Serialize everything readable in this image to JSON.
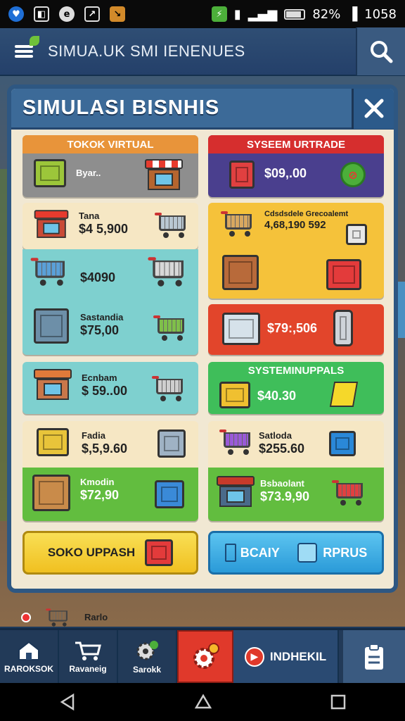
{
  "status_bar": {
    "battery_percent": "82%",
    "time": "1058"
  },
  "app_bar": {
    "title": "SIMUA.UK SMI IENENUES"
  },
  "modal": {
    "title": "SIMULASI BISNHIS",
    "left_header": "TOKOK VIRTUAL",
    "right_header": "SYSEEM URTRADE",
    "left_items": [
      {
        "name": "Byar..",
        "price": ""
      },
      {
        "name": "Tana",
        "price": "$4 5,900"
      },
      {
        "name": "",
        "price": "$4090"
      },
      {
        "name": "Sastandia",
        "price": "$75,00"
      },
      {
        "name": "Ecnbam",
        "price": "$ 59..00"
      },
      {
        "name": "Fadia",
        "price": "$,5,9.60"
      },
      {
        "name": "Kmodin",
        "price": "$72,90"
      }
    ],
    "right_items": [
      {
        "name": "",
        "price": "$09,.00"
      },
      {
        "name": "Cdsdsdele Grecoalemt",
        "price": "4,68,190 592"
      },
      {
        "name": "",
        "price": "$79:,506"
      },
      {
        "name": "SYSTEMINUPPALS",
        "price": "$40.30"
      },
      {
        "name": "Satloda",
        "price": "$255.60"
      },
      {
        "name": "Bsbaolant",
        "price": "$73.9,90"
      }
    ],
    "buttons": {
      "left": "SOKO UPPASH",
      "right_a": "BCAIY",
      "right_b": "RPRUS"
    }
  },
  "background": {
    "partial_label": "Rarlo"
  },
  "bottom_nav": {
    "items": [
      "RAROKSOK",
      "Ravaneig",
      "Sarokk"
    ],
    "next_label": "INDHEKIL"
  },
  "colors": {
    "modal_border": "#2e5782",
    "header_orange": "#e8943a",
    "header_red": "#d62e2e",
    "panel_grey": "#8e8e8e",
    "panel_purple": "#4a3f8e",
    "panel_cream": "#f6e7c4",
    "panel_teal": "#7ed0cf",
    "panel_yellow": "#f5c23a",
    "panel_red": "#e2452b",
    "panel_green": "#3fbe5a",
    "button_yellow": "#f4cf2d",
    "button_blue": "#3aaee0"
  }
}
